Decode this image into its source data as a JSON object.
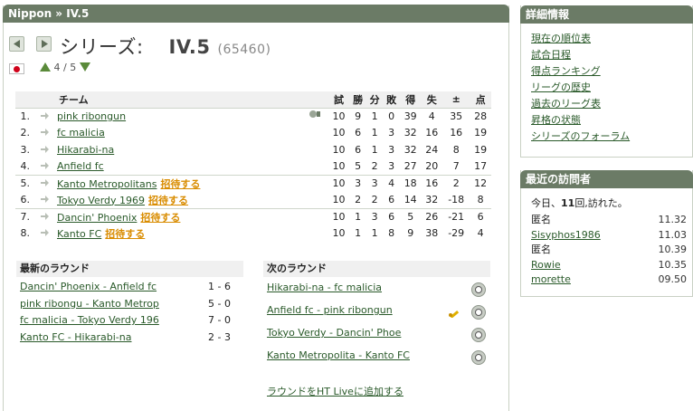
{
  "breadcrumb": "Nippon » IV.5",
  "title": {
    "label": "シリーズ:",
    "name": "IV.5",
    "id": "(65460)"
  },
  "level": {
    "current": "4",
    "separator": "/",
    "total": "5"
  },
  "colors": {
    "header_bar": "#6b7b66",
    "invite": "#d98c00",
    "link": "#2a5a2a",
    "flag_red": "#d0021b"
  },
  "table": {
    "headers": {
      "team": "チーム",
      "played": "試",
      "won": "勝",
      "draw": "分",
      "lost": "敗",
      "for": "得",
      "against": "失",
      "diff": "±",
      "points": "点"
    },
    "rows": [
      {
        "pos": "1.",
        "team": "pink ribongun",
        "invite": "",
        "p": "10",
        "w": "9",
        "d": "1",
        "l": "0",
        "gf": "39",
        "ga": "4",
        "gd": "35",
        "pts": "28",
        "icon": "trophy-icon"
      },
      {
        "pos": "2.",
        "team": "fc malicia",
        "invite": "",
        "p": "10",
        "w": "6",
        "d": "1",
        "l": "3",
        "gf": "32",
        "ga": "16",
        "gd": "16",
        "pts": "19"
      },
      {
        "pos": "3.",
        "team": "Hikarabi-na",
        "invite": "",
        "p": "10",
        "w": "6",
        "d": "1",
        "l": "3",
        "gf": "32",
        "ga": "24",
        "gd": "8",
        "pts": "19"
      },
      {
        "pos": "4.",
        "team": "Anfield fc",
        "invite": "",
        "p": "10",
        "w": "5",
        "d": "2",
        "l": "3",
        "gf": "27",
        "ga": "20",
        "gd": "7",
        "pts": "17"
      },
      {
        "pos": "5.",
        "team": "Kanto Metropolitans",
        "invite": "招待する",
        "p": "10",
        "w": "3",
        "d": "3",
        "l": "4",
        "gf": "18",
        "ga": "16",
        "gd": "2",
        "pts": "12"
      },
      {
        "pos": "6.",
        "team": "Tokyo Verdy 1969",
        "invite": "招待する",
        "p": "10",
        "w": "2",
        "d": "2",
        "l": "6",
        "gf": "14",
        "ga": "32",
        "gd": "-18",
        "pts": "8"
      },
      {
        "pos": "7.",
        "team": "Dancin' Phoenix",
        "invite": "招待する",
        "p": "10",
        "w": "1",
        "d": "3",
        "l": "6",
        "gf": "5",
        "ga": "26",
        "gd": "-21",
        "pts": "6"
      },
      {
        "pos": "8.",
        "team": "Kanto FC",
        "invite": "招待する",
        "p": "10",
        "w": "1",
        "d": "1",
        "l": "8",
        "gf": "9",
        "ga": "38",
        "gd": "-29",
        "pts": "4"
      }
    ]
  },
  "latest_round": {
    "heading": "最新のラウンド",
    "matches": [
      {
        "match": "Dancin' Phoenix - Anfield fc",
        "score": "1 - 6"
      },
      {
        "match": "pink ribongu - Kanto Metrop",
        "score": "5 - 0"
      },
      {
        "match": "fc malicia - Tokyo Verdy 196",
        "score": "7 - 0"
      },
      {
        "match": "Kanto FC - Hikarabi-na",
        "score": "2 - 3"
      }
    ]
  },
  "next_round": {
    "heading": "次のラウンド",
    "matches": [
      {
        "match": "Hikarabi-na - fc malicia"
      },
      {
        "match": "Anfield fc - pink ribongun"
      },
      {
        "match": "Tokyo Verdy  - Dancin' Phoe"
      },
      {
        "match": "Kanto Metropolita - Kanto FC"
      }
    ],
    "add_link": "ラウンドをHT Liveに追加する"
  },
  "details": {
    "heading": "詳細情報",
    "links": [
      "現在の順位表",
      "試合日程",
      "得点ランキング",
      "リーグの歴史",
      "過去のリーグ表",
      "昇格の状態",
      "シリーズのフォーラム"
    ]
  },
  "visitors": {
    "heading": "最近の訪問者",
    "summary_prefix": "今日、",
    "summary_count": "11",
    "summary_suffix": "回,訪れた。",
    "list": [
      {
        "name": "匿名",
        "time": "11.32",
        "link": false
      },
      {
        "name": "Sisyphos1986",
        "time": "11.03",
        "link": true
      },
      {
        "name": "匿名",
        "time": "10.39",
        "link": false
      },
      {
        "name": "Rowie",
        "time": "10.35",
        "link": true
      },
      {
        "name": "morette",
        "time": "09.50",
        "link": true
      }
    ]
  }
}
